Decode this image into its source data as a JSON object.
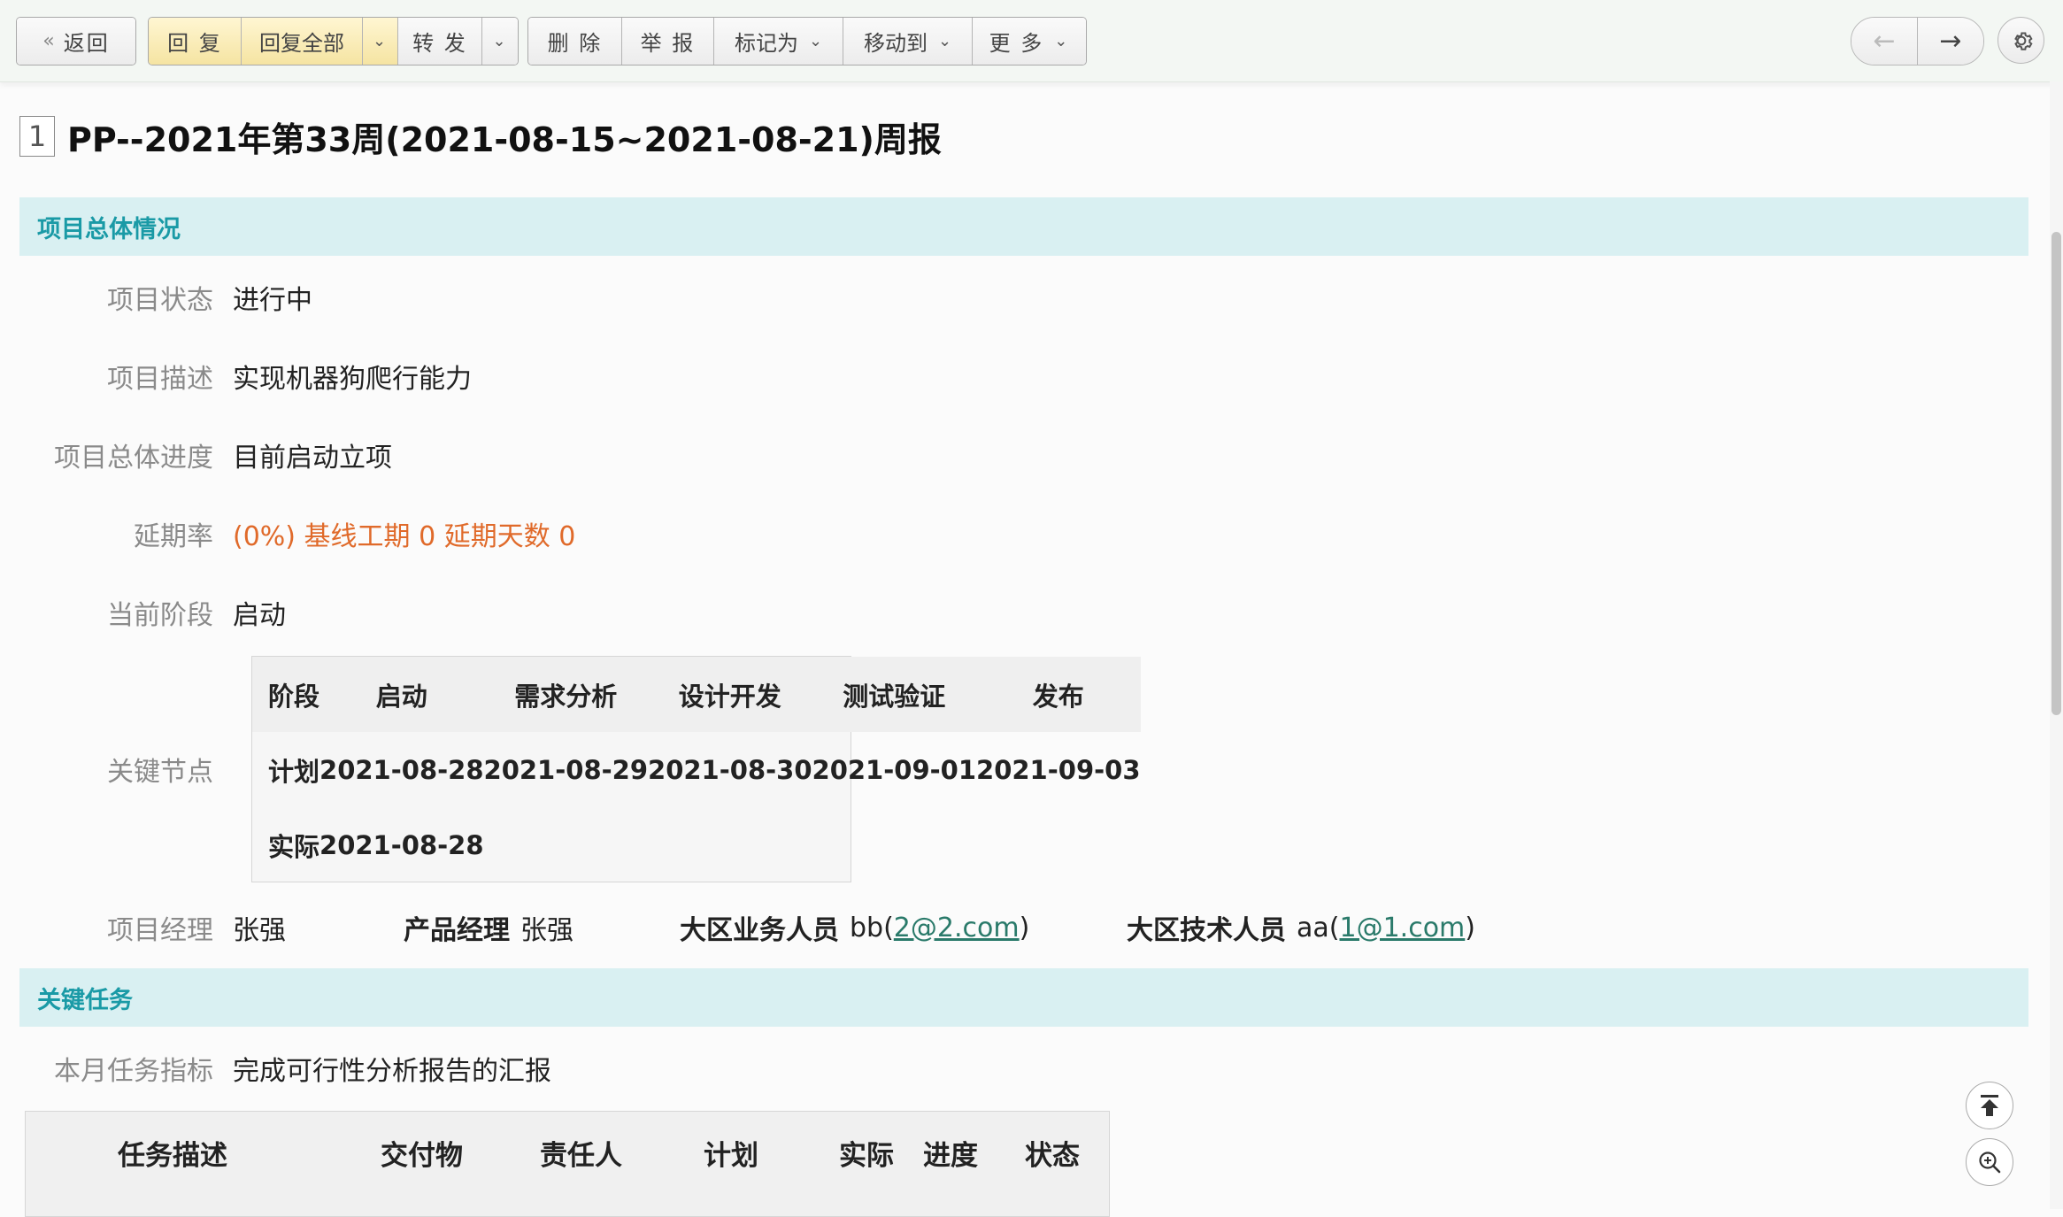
{
  "toolbar": {
    "back": "返回",
    "reply": "回 复",
    "reply_all": "回复全部",
    "forward": "转 发",
    "delete": "删 除",
    "report": "举 报",
    "mark_as": "标记为",
    "move_to": "移动到",
    "more": "更 多",
    "prev_arrow": "←",
    "next_arrow": "→"
  },
  "mail": {
    "index": "1",
    "subject": "PP--2021年第33周(2021-08-15~2021-08-21)周报"
  },
  "overview": {
    "header": "项目总体情况",
    "status_label": "项目状态",
    "status_value": "进行中",
    "desc_label": "项目描述",
    "desc_value": "实现机器狗爬行能力",
    "progress_label": "项目总体进度",
    "progress_value": "目前启动立项",
    "delay_label": "延期率",
    "delay_value": "(0%) 基线工期 0 延期天数 0",
    "stage_label": "当前阶段",
    "stage_value": "启动",
    "milestone_label": "关键节点",
    "milestones": {
      "header": [
        "阶段",
        "启动",
        "需求分析",
        "设计开发",
        "测试验证",
        "发布"
      ],
      "plan": [
        "计划",
        "2021-08-28",
        "2021-08-29",
        "2021-08-30",
        "2021-09-01",
        "2021-09-03"
      ],
      "actual": [
        "实际",
        "2021-08-28",
        "",
        "",
        "",
        ""
      ]
    },
    "pm_label": "项目经理",
    "pm_value": "张强",
    "product_manager_label": "产品经理",
    "product_manager_value": "张强",
    "sales_label": "大区业务人员",
    "sales_name": "bb(",
    "sales_email": "2@2.com",
    "tech_label": "大区技术人员",
    "tech_name": "aa(",
    "tech_email": "1@1.com",
    "close_paren": ")"
  },
  "tasks": {
    "header": "关键任务",
    "target_label": "本月任务指标",
    "target_value": "完成可行性分析报告的汇报",
    "columns": [
      "任务描述",
      "交付物",
      "责任人",
      "计划",
      "实际",
      "进度",
      "状态"
    ]
  },
  "colors": {
    "accent": "#1a9aa6",
    "section_bg": "#d9f0f2",
    "warning": "#e06a2a",
    "link": "#2a7a6a"
  }
}
